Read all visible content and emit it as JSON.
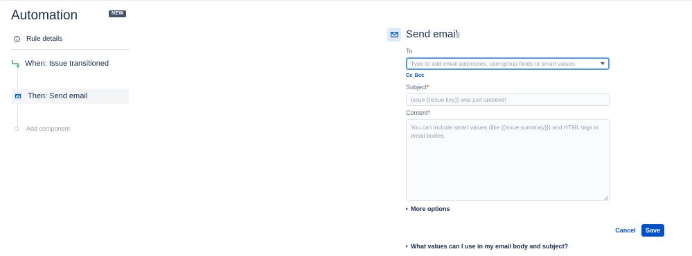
{
  "sidebar": {
    "title": "Automation",
    "badge": "NEW",
    "rule_details": "Rule details",
    "steps": [
      {
        "label": "When: Issue transitioned",
        "icon": "transition-icon"
      },
      {
        "label": "Then: Send email",
        "icon": "mail-icon",
        "selected": true
      }
    ],
    "add_component": "Add component"
  },
  "panel": {
    "title": "Send email",
    "to": {
      "label": "To",
      "placeholder": "Type to add email addresses, user/group fields or smart values."
    },
    "cc": "Cc",
    "bcc": "Bcc",
    "subject": {
      "label": "Subject",
      "required": "*",
      "placeholder": "Issue {{issue.key}} was just updated!"
    },
    "content": {
      "label": "Content",
      "required": "*",
      "placeholder": "You can include smart values (like {{issue.summary}}) and HTML tags in email bodies."
    },
    "more_options": "More options",
    "cancel": "Cancel",
    "save": "Save",
    "help": "What values can I use in my email body and subject?"
  },
  "colors": {
    "accent": "#0052cc",
    "badge": "#42526e",
    "trigger": "#36b37e",
    "required": "#de350b"
  }
}
